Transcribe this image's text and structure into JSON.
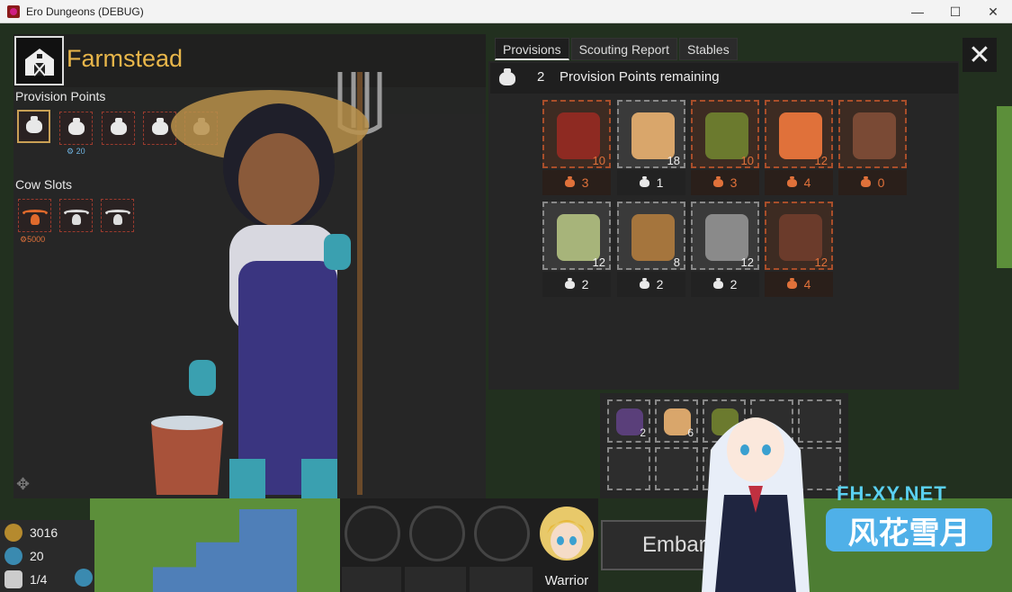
{
  "window": {
    "title": "Ero Dungeons (DEBUG)",
    "minimize": "—",
    "maximize": "☐",
    "close": "✕"
  },
  "building": {
    "title": "Farmstead"
  },
  "left": {
    "provision_points_label": "Provision Points",
    "provision_slot_value": "20",
    "cow_slots_label": "Cow Slots",
    "cow_slot_value": "5000"
  },
  "tabs": [
    {
      "label": "Provisions",
      "active": true
    },
    {
      "label": "Scouting Report",
      "active": false
    },
    {
      "label": "Stables",
      "active": false
    }
  ],
  "provision_points": {
    "remaining": "2",
    "label": "Provision Points remaining"
  },
  "items": [
    {
      "name": "red-potion",
      "count": "10",
      "cost": "3",
      "affordable": false,
      "color": "#8e2a22"
    },
    {
      "name": "bread",
      "count": "18",
      "cost": "1",
      "affordable": true,
      "color": "#d9a66b"
    },
    {
      "name": "herbs",
      "count": "10",
      "cost": "3",
      "affordable": false,
      "color": "#6b7a2e"
    },
    {
      "name": "fire-flask",
      "count": "12",
      "cost": "4",
      "affordable": false,
      "color": "#e0713a"
    },
    {
      "name": "milk-can",
      "count": "",
      "cost": "0",
      "affordable": false,
      "color": "#7a4a35"
    },
    {
      "name": "jar",
      "count": "12",
      "cost": "2",
      "affordable": true,
      "color": "#a7b47a"
    },
    {
      "name": "rope",
      "count": "8",
      "cost": "2",
      "affordable": true,
      "color": "#a5753d"
    },
    {
      "name": "bandage",
      "count": "12",
      "cost": "2",
      "affordable": true,
      "color": "#8a8a8a"
    },
    {
      "name": "frost-flask",
      "count": "12",
      "cost": "4",
      "affordable": false,
      "color": "#6b3b2b"
    }
  ],
  "inventory": [
    {
      "name": "purple-potion",
      "count": "2",
      "color": "#5a3f7a"
    },
    {
      "name": "bread",
      "count": "6",
      "color": "#d9a66b"
    },
    {
      "name": "herbs",
      "count": "",
      "color": "#6b7a2e"
    }
  ],
  "resources": {
    "gold": "3016",
    "mana": "20",
    "slots": "1/4"
  },
  "party": {
    "class_label": "Warrior"
  },
  "embark": {
    "label": "Embark"
  },
  "watermark": {
    "domain": "FH-XY.NET",
    "brand": "风花雪月"
  },
  "colors": {
    "accent": "#e8b64a",
    "cost_orange": "#e0713a",
    "panel": "#262626"
  }
}
